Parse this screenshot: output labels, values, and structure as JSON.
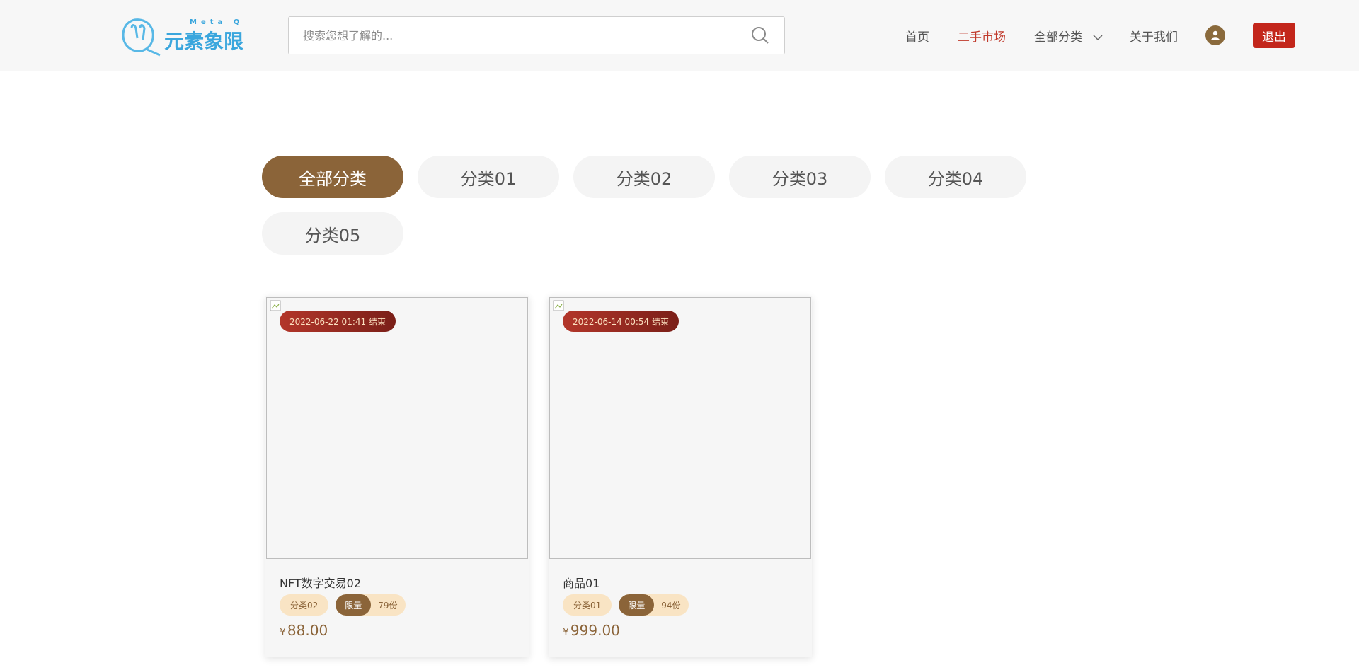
{
  "header": {
    "logo_text": "元素象限",
    "logo_subtext": "Meta Q",
    "search_placeholder": "搜索您想了解的...",
    "nav": {
      "home": "首页",
      "market": "二手市场",
      "categories": "全部分类",
      "about": "关于我们"
    },
    "logout": "退出"
  },
  "categories": [
    "全部分类",
    "分类01",
    "分类02",
    "分类03",
    "分类04",
    "分类05"
  ],
  "active_category": "全部分类",
  "products": [
    {
      "end_time": "2022-06-22 01:41 结束",
      "name": "NFT数字交易02",
      "category": "分类02",
      "limit_label": "限量",
      "limit_count": "79份",
      "currency": "¥",
      "price": "88.00"
    },
    {
      "end_time": "2022-06-14 00:54 结束",
      "name": "商品01",
      "category": "分类01",
      "limit_label": "限量",
      "limit_count": "94份",
      "currency": "¥",
      "price": "999.00"
    }
  ],
  "colors": {
    "brand_brown": "#8b6439",
    "accent_red": "#c3261b",
    "active_nav": "#c0392b",
    "logo_blue": "#3aa6dd"
  }
}
